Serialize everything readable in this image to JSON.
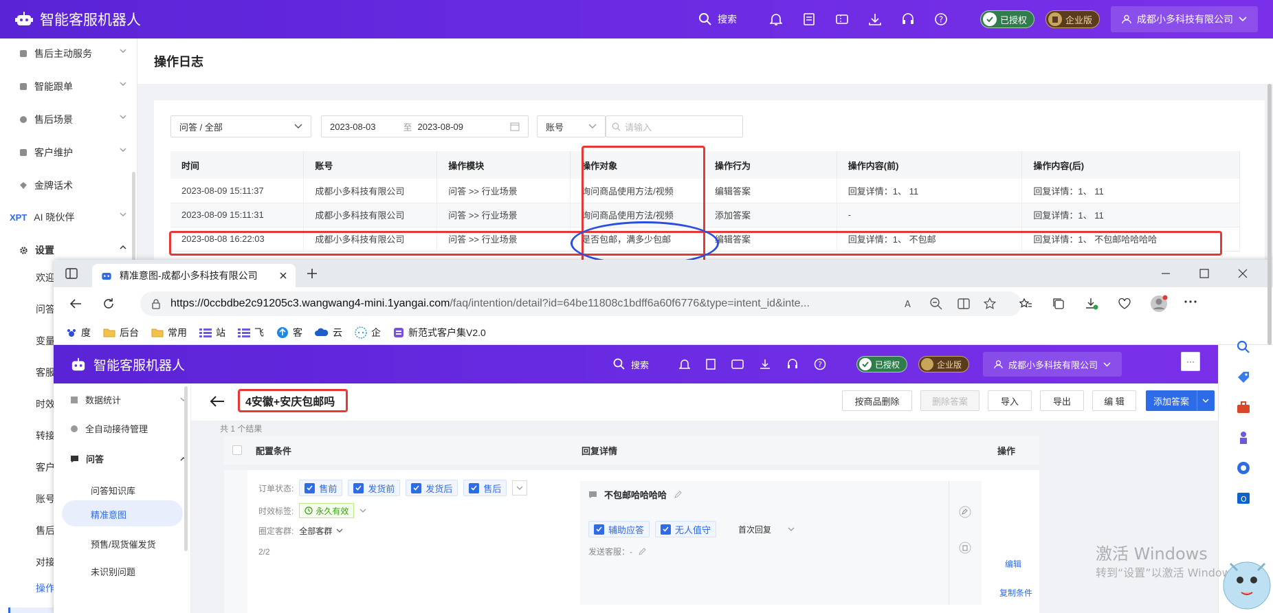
{
  "app": {
    "title": "智能客服机器人"
  },
  "header": {
    "search_label": "搜索",
    "badge_authorized": "已授权",
    "badge_enterprise": "企业版",
    "company": "成都小多科技有限公司"
  },
  "sidebar": {
    "items": [
      {
        "label": "售后主动服务"
      },
      {
        "label": "智能跟单"
      },
      {
        "label": "售后场景"
      },
      {
        "label": "客户维护"
      },
      {
        "label": "金牌话术"
      },
      {
        "label": "AI 晓伙伴",
        "prefix": "XPT"
      },
      {
        "label": "设置"
      }
    ],
    "subs": [
      "欢迎",
      "问答",
      "变量",
      "客服",
      "时效",
      "转接",
      "客户",
      "账号",
      "售后",
      "对接",
      "操作"
    ]
  },
  "page": {
    "title": "操作日志"
  },
  "filters": {
    "category": "问答 / 全部",
    "date_from": "2023-08-03",
    "date_sep": "至",
    "date_to": "2023-08-09",
    "field": "账号",
    "search_placeholder": "请输入"
  },
  "log_table": {
    "headers": [
      "时间",
      "账号",
      "操作模块",
      "操作对象",
      "操作行为",
      "操作内容(前)",
      "操作内容(后)"
    ],
    "rows": [
      [
        "2023-08-09 15:11:37",
        "成都小多科技有限公司",
        "问答 >> 行业场景",
        "询问商品使用方法/视频",
        "编辑答案",
        "回复详情：1、 11",
        "回复详情：1、 11"
      ],
      [
        "2023-08-09 15:11:31",
        "成都小多科技有限公司",
        "问答 >> 行业场景",
        "询问商品使用方法/视频",
        "添加答案",
        "-",
        "回复详情：1、 11"
      ],
      [
        "2023-08-08 16:22:03",
        "成都小多科技有限公司",
        "问答 >> 行业场景",
        "是否包邮，满多少包邮",
        "编辑答案",
        "回复详情：1、 不包邮",
        "回复详情：1、 不包邮哈哈哈哈"
      ]
    ]
  },
  "browser": {
    "tab_title": "精准意图-成都小多科技有限公司",
    "url_host": "https://0ccbdbe2c91205c3.wangwang4-mini.1yangai.com",
    "url_rest": "/faq/intention/detail?id=64be11808c1bdff6a60f6776&type=intent_id&inte...",
    "bookmarks": [
      "度",
      "后台",
      "常用",
      "站",
      "飞",
      "客",
      "云",
      "企",
      "新范式客户集V2.0"
    ]
  },
  "inner": {
    "sidebar": {
      "items": [
        "数据统计",
        "全自动接待管理",
        "问答"
      ],
      "subs": [
        "问答知识库",
        "精准意图",
        "预售/现货催发货",
        "未识别问题"
      ]
    },
    "intent_title": "4安徽+安庆包邮吗",
    "buttons": {
      "delete_by_product": "按商品删除",
      "delete_answer": "删除答案",
      "import": "导入",
      "export": "导出",
      "edit": "编 辑",
      "add_answer": "添加答案",
      "more": "···"
    },
    "result_count": "共 1 个结果",
    "columns": {
      "conditions": "配置条件",
      "reply": "回复详情",
      "action": "操作"
    },
    "order_status_label": "订单状态:",
    "order_status_tags": [
      "售前",
      "发货前",
      "发货后",
      "售后"
    ],
    "time_label": "时效标签:",
    "time_value": "永久有效",
    "group_label": "圈定客群:",
    "group_value": "全部客群",
    "pagination": "2/2",
    "reply_text": "不包邮哈哈哈哈",
    "reply_checks": [
      "辅助应答",
      "无人值守"
    ],
    "reply_mode": "首次回复",
    "sender_label": "发送客服：-",
    "edit_link": "编辑",
    "copy_link": "复制条件"
  },
  "watermark": {
    "line1": "激活 Windows",
    "line2": "转到“设置”以激活 Windows。"
  },
  "colors": {
    "brand_purple": "#6a2be2",
    "accent_blue": "#2e6be6",
    "annotation_red": "#e53935",
    "annotation_blue": "#2a4fe0"
  }
}
